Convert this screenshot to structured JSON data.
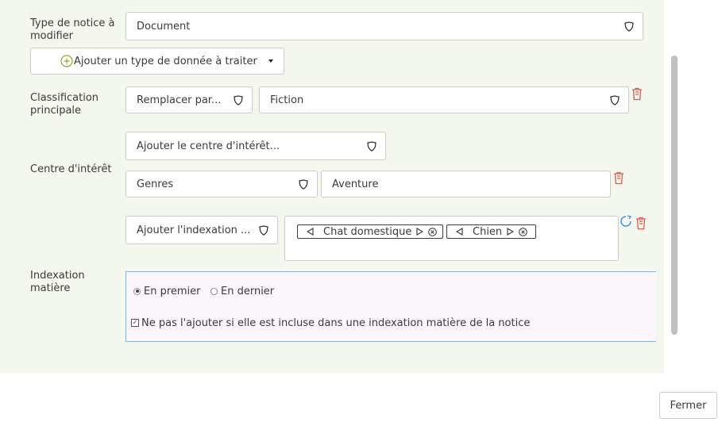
{
  "labels": {
    "type_notice": "Type de notice à modifier",
    "classification": "Classification principale",
    "centre_interet": "Centre d'intérêt",
    "indexation": "Indexation matière"
  },
  "fields": {
    "type_notice_value": "Document",
    "add_data_type": "Ajouter un type de donnée à traiter",
    "classification_action": "Remplacer par...",
    "classification_value": "Fiction",
    "add_centre_interet": "Ajouter le centre d'intérêt...",
    "genres": "Genres",
    "genres_value": "Aventure",
    "add_indexation": "Ajouter l'indexation ..."
  },
  "tags": [
    {
      "label": "Chat domestique"
    },
    {
      "label": "Chien"
    }
  ],
  "position_options": {
    "first": "En premier",
    "last": "En dernier",
    "selected": "first"
  },
  "checkbox": {
    "label": "Ne pas l'ajouter si elle est incluse dans une indexation matière de la notice",
    "checked": true
  },
  "buttons": {
    "close": "Fermer"
  },
  "colors": {
    "panel_bg": "#f4f7ee",
    "delete_icon": "#e05a4a",
    "add_icon": "#9aa42a",
    "refresh_icon": "#3a8ee6",
    "indexation_box_border": "#8fb0d8"
  }
}
